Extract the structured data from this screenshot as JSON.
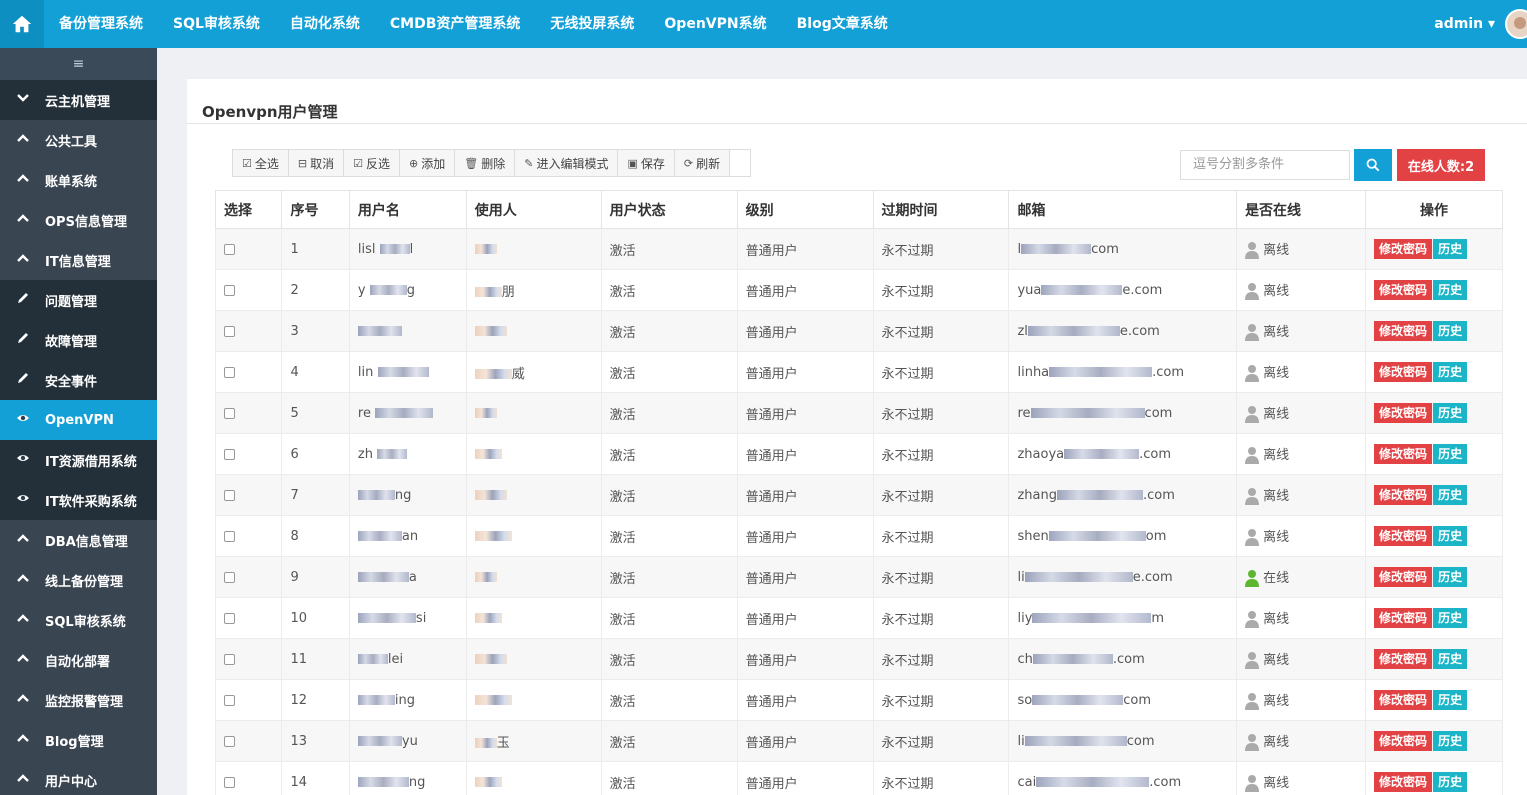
{
  "topnav": {
    "items": [
      "备份管理系统",
      "SQL审核系统",
      "自动化系统",
      "CMDB资产管理系统",
      "无线投屏系统",
      "OpenVPN系统",
      "Blog文章系统"
    ],
    "user": "admin",
    "accent": "#12a0d7"
  },
  "sidebar": {
    "toggle": "≡",
    "items": [
      {
        "label": "云主机管理",
        "icon": "chevron-down-icon"
      },
      {
        "label": "公共工具",
        "icon": "chevron-up-icon"
      },
      {
        "label": "账单系统",
        "icon": "chevron-up-icon"
      },
      {
        "label": "OPS信息管理",
        "icon": "chevron-up-icon"
      },
      {
        "label": "IT信息管理",
        "icon": "chevron-up-icon"
      },
      {
        "label": "问题管理",
        "icon": "pencil-icon"
      },
      {
        "label": "故障管理",
        "icon": "pencil-icon"
      },
      {
        "label": "安全事件",
        "icon": "pencil-icon"
      },
      {
        "label": "OpenVPN",
        "icon": "eye-icon"
      },
      {
        "label": "IT资源借用系统",
        "icon": "eye-icon"
      },
      {
        "label": "IT软件采购系统",
        "icon": "eye-icon"
      },
      {
        "label": "DBA信息管理",
        "icon": "chevron-up-icon"
      },
      {
        "label": "线上备份管理",
        "icon": "chevron-up-icon"
      },
      {
        "label": "SQL审核系统",
        "icon": "chevron-up-icon"
      },
      {
        "label": "自动化部署",
        "icon": "chevron-up-icon"
      },
      {
        "label": "监控报警管理",
        "icon": "chevron-up-icon"
      },
      {
        "label": "Blog管理",
        "icon": "chevron-up-icon"
      },
      {
        "label": "用户中心",
        "icon": "chevron-up-icon"
      }
    ]
  },
  "page": {
    "title": "Openvpn用户管理"
  },
  "toolbar": {
    "select_all": "全选",
    "cancel": "取消",
    "invert": "反选",
    "add": "添加",
    "delete": "删除",
    "edit_mode": "进入编辑模式",
    "save": "保存",
    "refresh": "刷新"
  },
  "search": {
    "placeholder": "逗号分割多条件"
  },
  "online_count": "在线人数:2",
  "table": {
    "headers": [
      "选择",
      "序号",
      "用户名",
      "使用人",
      "用户状态",
      "级别",
      "过期时间",
      "邮箱",
      "是否在线",
      "操作"
    ],
    "rows": [
      {
        "no": "1",
        "user": "lisl",
        "user_tail": "l",
        "owner_tail": "",
        "status": "激活",
        "level": "普通用户",
        "expire": "永不过期",
        "email_head": "l",
        "email_tail": "com",
        "online": "离线"
      },
      {
        "no": "2",
        "user": "y",
        "user_tail": "g",
        "owner_tail": "朋",
        "status": "激活",
        "level": "普通用户",
        "expire": "永不过期",
        "email_head": "yua",
        "email_tail": "e.com",
        "online": "离线"
      },
      {
        "no": "3",
        "user": "",
        "user_tail": "",
        "owner_tail": "",
        "status": "激活",
        "level": "普通用户",
        "expire": "永不过期",
        "email_head": "zl",
        "email_tail": "e.com",
        "online": "离线"
      },
      {
        "no": "4",
        "user": "lin",
        "user_tail": "",
        "owner_tail": "威",
        "status": "激活",
        "level": "普通用户",
        "expire": "永不过期",
        "email_head": "linha",
        "email_tail": ".com",
        "online": "离线"
      },
      {
        "no": "5",
        "user": "re",
        "user_tail": "",
        "owner_tail": "",
        "status": "激活",
        "level": "普通用户",
        "expire": "永不过期",
        "email_head": "re",
        "email_tail": "com",
        "online": "离线"
      },
      {
        "no": "6",
        "user": "zh",
        "user_tail": "",
        "owner_tail": "",
        "status": "激活",
        "level": "普通用户",
        "expire": "永不过期",
        "email_head": "zhaoya",
        "email_tail": ".com",
        "online": "离线"
      },
      {
        "no": "7",
        "user": "",
        "user_tail": "ng",
        "owner_tail": "",
        "status": "激活",
        "level": "普通用户",
        "expire": "永不过期",
        "email_head": "zhang",
        "email_tail": ".com",
        "online": "离线"
      },
      {
        "no": "8",
        "user": "",
        "user_tail": "an",
        "owner_tail": "",
        "status": "激活",
        "level": "普通用户",
        "expire": "永不过期",
        "email_head": "shen",
        "email_tail": "om",
        "online": "离线"
      },
      {
        "no": "9",
        "user": "",
        "user_tail": "a",
        "owner_tail": "",
        "status": "激活",
        "level": "普通用户",
        "expire": "永不过期",
        "email_head": "li",
        "email_tail": "e.com",
        "online": "在线"
      },
      {
        "no": "10",
        "user": "",
        "user_tail": "si",
        "owner_tail": "",
        "status": "激活",
        "level": "普通用户",
        "expire": "永不过期",
        "email_head": "liy",
        "email_tail": "m",
        "online": "离线"
      },
      {
        "no": "11",
        "user": "",
        "user_tail": "lei",
        "owner_tail": "",
        "status": "激活",
        "level": "普通用户",
        "expire": "永不过期",
        "email_head": "ch",
        "email_tail": ".com",
        "online": "离线"
      },
      {
        "no": "12",
        "user": "",
        "user_tail": "ing",
        "owner_tail": "",
        "status": "激活",
        "level": "普通用户",
        "expire": "永不过期",
        "email_head": "so",
        "email_tail": "com",
        "online": "离线"
      },
      {
        "no": "13",
        "user": "",
        "user_tail": "yu",
        "owner_tail": "玉",
        "status": "激活",
        "level": "普通用户",
        "expire": "永不过期",
        "email_head": "li",
        "email_tail": "com",
        "online": "离线"
      },
      {
        "no": "14",
        "user": "",
        "user_tail": "ng",
        "owner_tail": "",
        "status": "激活",
        "level": "普通用户",
        "expire": "永不过期",
        "email_head": "cai",
        "email_tail": ".com",
        "online": "离线"
      }
    ],
    "op_password": "修改密码",
    "op_history": "历史"
  },
  "colors": {
    "online_icon": "#5cb630",
    "offline_icon": "#aaaaaa",
    "danger": "#e34245",
    "info": "#1bb5c7"
  }
}
